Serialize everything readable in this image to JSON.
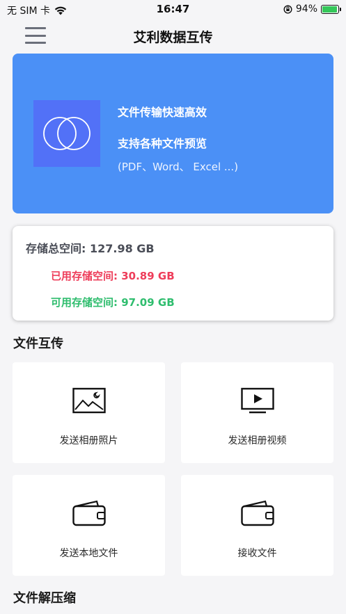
{
  "status_bar": {
    "carrier": "无 SIM 卡",
    "time": "16:47",
    "battery_percent": "94%",
    "battery_level": 0.94,
    "icons": [
      "wifi-icon",
      "orientation-lock-icon",
      "battery-charging-icon"
    ]
  },
  "nav": {
    "title": "艾利数据互传",
    "menu_icon": "hamburger-menu-icon"
  },
  "banner": {
    "line1": "文件传输快速高效",
    "line2": "支持各种文件预览",
    "line3": "(PDF、Word、 Excel ...)",
    "logo_icon": "interlocking-circles-icon"
  },
  "storage": {
    "total": "存储总空间: 127.98 GB",
    "used": "已用存储空间: 30.89 GB",
    "free": "可用存储空间: 97.09 GB"
  },
  "sections": {
    "transfer_title": "文件互传",
    "unzip_title": "文件解压缩"
  },
  "tiles": [
    {
      "label": "发送相册照片",
      "icon": "photo-icon"
    },
    {
      "label": "发送相册视频",
      "icon": "video-play-icon"
    },
    {
      "label": "发送本地文件",
      "icon": "wallet-folder-icon"
    },
    {
      "label": "接收文件",
      "icon": "wallet-folder-icon"
    }
  ],
  "colors": {
    "banner": "#4b90f6",
    "logo_bg": "#5271f7",
    "used": "#ee3d5a",
    "free": "#2fbd6e",
    "battery": "#34c759"
  }
}
